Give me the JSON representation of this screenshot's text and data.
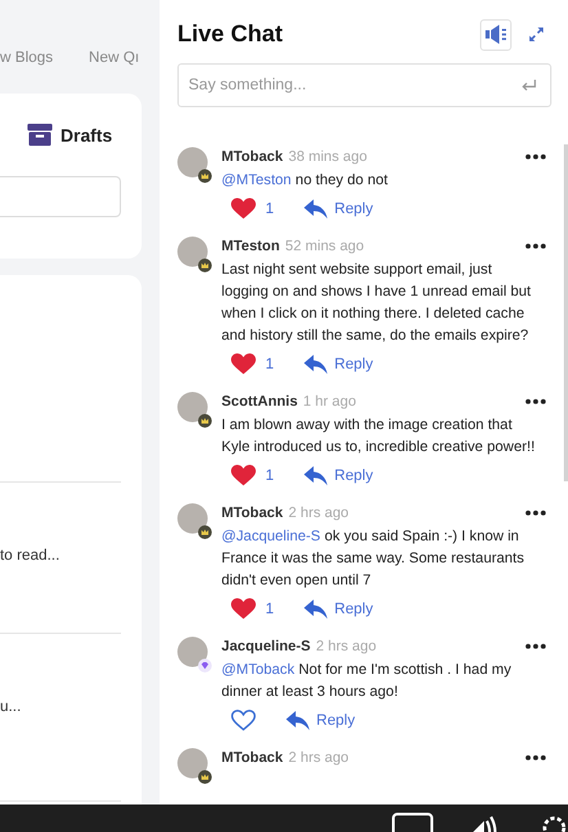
{
  "left_panel": {
    "nav_items": [
      "w Blogs",
      "New Qı"
    ],
    "drafts_label": "Drafts",
    "list_snippets": [
      "to read...",
      "u..."
    ]
  },
  "chat": {
    "title": "Live Chat",
    "input": {
      "placeholder": "Say something..."
    },
    "messages": [
      {
        "author": "MToback",
        "time": "38 mins ago",
        "badge": {
          "kind": "crown"
        },
        "mention": "@MTeston",
        "text": "no they do not",
        "liked": true,
        "likes": "1",
        "reply": "Reply"
      },
      {
        "author": "MTeston",
        "time": "52 mins ago",
        "badge": {
          "kind": "crown"
        },
        "text": "Last night sent website support email, just logging on and shows I have 1 unread email but when I click on it nothing there. I deleted cache and history still the same, do the emails expire?",
        "liked": true,
        "likes": "1",
        "reply": "Reply"
      },
      {
        "author": "ScottAnnis",
        "time": "1 hr ago",
        "badge": {
          "kind": "crown"
        },
        "text": "I am blown away with the image creation that Kyle introduced us to, incredible creative power!!",
        "liked": true,
        "likes": "1",
        "reply": "Reply"
      },
      {
        "author": "MToback",
        "time": "2 hrs ago",
        "badge": {
          "kind": "crown"
        },
        "mention": "@Jacqueline-S",
        "text": "ok you said Spain :-) I know in France it was the same way. Some restaurants didn't even open until 7",
        "liked": true,
        "likes": "1",
        "reply": "Reply"
      },
      {
        "author": "Jacqueline-S",
        "time": "2 hrs ago",
        "badge": {
          "kind": "diamond"
        },
        "mention": "@MToback",
        "text": "Not for me I'm scottish . I had my dinner at least 3 hours ago!",
        "liked": false,
        "reply": "Reply"
      },
      {
        "author": "MToback",
        "time": "2 hrs ago",
        "badge": {
          "kind": "crown"
        }
      }
    ]
  }
}
